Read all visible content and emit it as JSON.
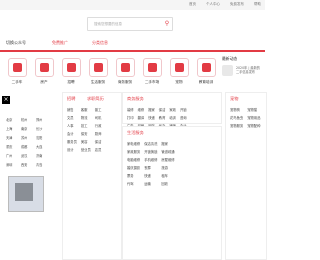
{
  "topbar": {
    "links": [
      "首页",
      "个人中心",
      "免费发布",
      "帮助"
    ]
  },
  "search": {
    "placeholder": "搜索您想要的信息"
  },
  "nav": {
    "items": [
      {
        "label": "切换公众号",
        "red": false
      },
      {
        "label": "免费推广",
        "red": true
      },
      {
        "label": "分类信息",
        "red": true
      }
    ]
  },
  "categories": [
    "二手车",
    "房产",
    "招聘",
    "生活服务",
    "商务服务",
    "二手市场",
    "宠物",
    "教育培训"
  ],
  "login": {
    "title": "最新动态",
    "desc": "2020年 | 最新的二手信息发布"
  },
  "sections": [
    {
      "title": "招聘",
      "title2": "求职简历",
      "items": [
        "销售",
        "客服",
        "普工",
        "文员",
        "物流",
        "司机",
        "人事",
        "技工",
        "行政",
        "会计",
        "保安",
        "厨师",
        "服务员",
        "美容",
        "保洁",
        "设计",
        "营业员",
        "店员"
      ]
    },
    {
      "title": "商务服务",
      "title2": "",
      "items": [
        "装修",
        "维修",
        "搬家",
        "保洁",
        "家政",
        "开锁",
        "打印",
        "翻译",
        "快递",
        "教育",
        "培训",
        "咨询",
        "广告",
        "印刷",
        "网站",
        "代办",
        "律师",
        "会计"
      ]
    },
    {
      "title": "宠物",
      "title2": "",
      "items": [
        "宠物狗",
        "宠物猫",
        "花鸟鱼虫",
        "宠物用品",
        "宠物服务",
        "宠物配种"
      ]
    },
    {
      "title": "生活服务",
      "title2": "",
      "items": [
        "家电维修",
        "保洁清洗",
        "搬家",
        "家政服务",
        "开锁换锁",
        "管道疏通",
        "电脑维修",
        "手机维修",
        "房屋维修",
        "婚庆摄影",
        "丧葬",
        "旅游",
        "票务",
        "快递",
        "租车",
        "代驾",
        "运输",
        "回收"
      ]
    }
  ],
  "side": {
    "rows": [
      "北京",
      "上海",
      "天津",
      "重庆",
      "广州",
      "深圳",
      "杭州",
      "南京",
      "苏州",
      "成都",
      "武汉",
      "西安",
      "郑州",
      "长沙",
      "沈阳",
      "大连",
      "济南",
      "青岛"
    ]
  }
}
